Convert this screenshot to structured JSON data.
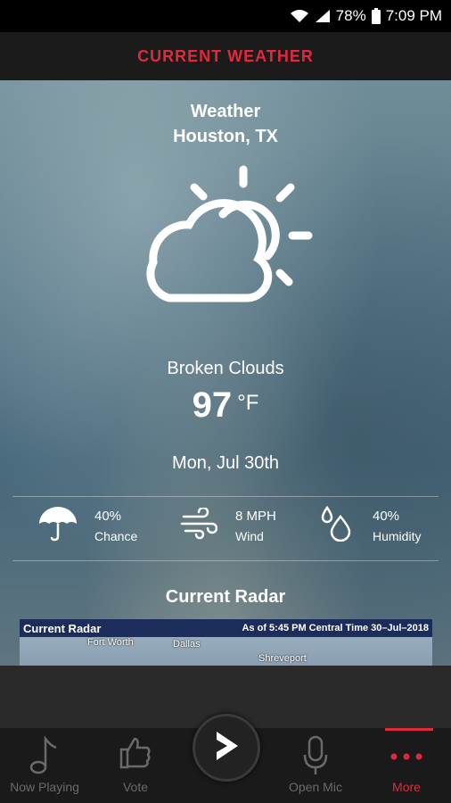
{
  "status_bar": {
    "battery": "78%",
    "time": "7:09 PM"
  },
  "header": {
    "title": "CURRENT WEATHER"
  },
  "location": {
    "title": "Weather",
    "city": "Houston, TX"
  },
  "current": {
    "condition": "Broken Clouds",
    "temperature": "97",
    "unit": "°F",
    "date": "Mon, Jul 30th",
    "icon": "partly-cloudy-icon"
  },
  "stats": [
    {
      "icon": "umbrella-icon",
      "value": "40%",
      "label": "Chance"
    },
    {
      "icon": "wind-icon",
      "value": "8 MPH",
      "label": "Wind"
    },
    {
      "icon": "humidity-icon",
      "value": "40%",
      "label": "Humidity"
    }
  ],
  "radar": {
    "section_title": "Current Radar",
    "image_title": "Current Radar",
    "image_timestamp": "As of 5:45  PM Central Time  30–Jul–2018",
    "cities": [
      "Fort Worth",
      "Dallas",
      "Shreveport"
    ]
  },
  "tabs": [
    {
      "label": "Now Playing",
      "icon": "music-note-icon"
    },
    {
      "label": "Vote",
      "icon": "thumbs-up-icon"
    },
    {
      "label": "Open Mic",
      "icon": "microphone-icon"
    },
    {
      "label": "More",
      "icon": "more-dots-icon"
    }
  ],
  "colors": {
    "accent": "#e02a3b",
    "header_bg": "#1b1b1c",
    "tabbar_bg": "#1a1a1a"
  }
}
